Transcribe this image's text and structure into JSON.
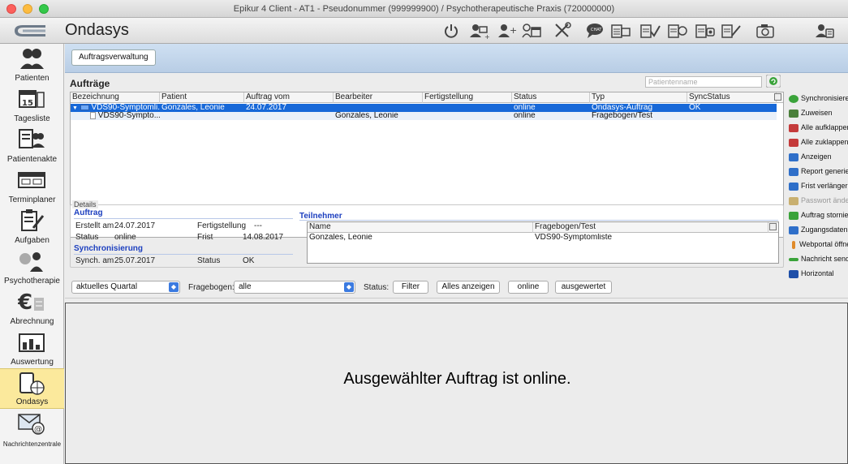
{
  "window": {
    "title": "Epikur 4 Client - AT1 - Pseudonummer (999999900) / Psychotherapeutische Praxis (720000000)"
  },
  "toolbar": {
    "app_title": "Ondasys",
    "icons": [
      "power-icon",
      "patient-add-icon",
      "user-add-icon",
      "patient-calendar-icon",
      "tools-icon",
      "chat-icon",
      "calendar-list-icon",
      "form-check-icon",
      "form-report-icon",
      "form-phone-icon",
      "form-sign-icon",
      "camera-icon",
      "user-settings-icon"
    ]
  },
  "sidebar": {
    "items": [
      {
        "label": "Patienten",
        "icon": "patients-icon"
      },
      {
        "label": "Tagesliste",
        "icon": "day-list-icon"
      },
      {
        "label": "Patientenakte",
        "icon": "patient-file-icon"
      },
      {
        "label": "Terminplaner",
        "icon": "scheduler-icon"
      },
      {
        "label": "Aufgaben",
        "icon": "tasks-icon"
      },
      {
        "label": "Psychotherapie",
        "icon": "psychotherapy-icon"
      },
      {
        "label": "Abrechnung",
        "icon": "billing-icon"
      },
      {
        "label": "Auswertung",
        "icon": "analytics-icon"
      },
      {
        "label": "Ondasys",
        "icon": "ondasys-icon"
      },
      {
        "label": "Nachrichtenzentrale",
        "icon": "message-center-icon"
      }
    ]
  },
  "main": {
    "tab_label": "Auftragsverwaltung",
    "section_title": "Aufträge",
    "search_placeholder": "Patientenname",
    "columns": [
      "Bezeichnung",
      "Patient",
      "Auftrag vom",
      "Bearbeiter",
      "Fertigstellung",
      "Status",
      "Typ",
      "SyncStatus"
    ],
    "rows": [
      [
        "VDS90-Symptomli...",
        "Gonzales, Leonie",
        "24.07.2017",
        "",
        "",
        "online",
        "Ondasys-Auftrag",
        "OK"
      ],
      [
        "VDS90-Sympto...",
        "",
        "",
        "Gonzales, Leonie",
        "",
        "online",
        "Fragebogen/Test",
        ""
      ]
    ]
  },
  "actions": [
    {
      "label": "Synchronisieren",
      "color": "#3aa33a",
      "enabled": true
    },
    {
      "label": "Zuweisen",
      "color": "#4a7f3a",
      "enabled": true
    },
    {
      "label": "Alle aufklappen",
      "color": "#c43a3a",
      "enabled": true
    },
    {
      "label": "Alle zuklappen",
      "color": "#c43a3a",
      "enabled": true
    },
    {
      "label": "Anzeigen",
      "color": "#2f6fc9",
      "enabled": true
    },
    {
      "label": "Report generieren",
      "color": "#2f6fc9",
      "enabled": true
    },
    {
      "label": "Frist verlängern",
      "color": "#2f6fc9",
      "enabled": true
    },
    {
      "label": "Passwort ändern",
      "color": "#c9b070",
      "enabled": false
    },
    {
      "label": "Auftrag stornieren",
      "color": "#3aa33a",
      "enabled": true
    },
    {
      "label": "Zugangsdaten",
      "color": "#2f6fc9",
      "enabled": true
    },
    {
      "label": "Webportal öffnen",
      "color": "#e08a2a",
      "enabled": true
    },
    {
      "label": "Nachricht senden",
      "color": "#3aa33a",
      "enabled": true
    },
    {
      "label": "Horizontal",
      "color": "#1e4fa8",
      "enabled": true
    }
  ],
  "details": {
    "legend": "Details",
    "auftrag_header": "Auftrag",
    "erstellt_label": "Erstellt am",
    "erstellt_value": "24.07.2017",
    "fertigstellung_label": "Fertigstellung",
    "fertigstellung_value": "---",
    "status_label": "Status",
    "status_value": "online",
    "frist_label": "Frist",
    "frist_value": "14.08.2017",
    "sync_header": "Synchronisierung",
    "synch_label": "Synch. am",
    "synch_value": "25.07.2017",
    "sync_status_label": "Status",
    "sync_status_value": "OK",
    "teilnehmer_header": "Teilnehmer",
    "teilnehmer_columns": [
      "Name",
      "Fragebogen/Test"
    ],
    "teilnehmer_rows": [
      [
        "Gonzales, Leonie",
        "VDS90-Symptomliste"
      ]
    ]
  },
  "filters": {
    "period_value": "aktuelles Quartal",
    "fragebogen_label": "Fragebogen:",
    "fragebogen_value": "alle",
    "status_label": "Status:",
    "buttons": [
      "Filter",
      "Alles anzeigen",
      "online",
      "ausgewertet"
    ]
  },
  "preview": {
    "message": "Ausgewählter Auftrag ist online."
  }
}
